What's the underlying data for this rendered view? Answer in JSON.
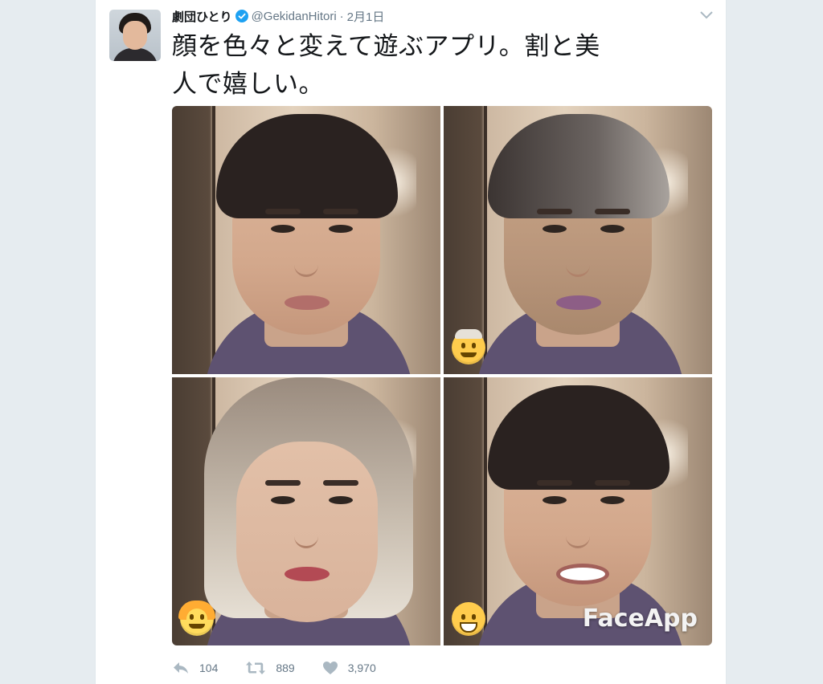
{
  "tweet": {
    "author_name": "劇団ひとり",
    "handle": "@GekidanHitori",
    "separator": "·",
    "time": "2月1日",
    "text": "顔を色々と変えて遊ぶアプリ。割と美人で嬉しい。",
    "text_line1": "顔を色々と変えて遊ぶアプリ。割と美",
    "text_line2": "人で嬉しい。"
  },
  "media": {
    "watermark": "FaceApp",
    "tiles": [
      {
        "filter": "original",
        "emoji_icon": ""
      },
      {
        "filter": "old",
        "emoji_icon": "older-man-emoji"
      },
      {
        "filter": "female",
        "emoji_icon": "woman-emoji"
      },
      {
        "filter": "smile",
        "emoji_icon": "grinning-face-emoji"
      }
    ]
  },
  "actions": {
    "reply_count": "104",
    "retweet_count": "889",
    "like_count": "3,970"
  },
  "colors": {
    "background": "#e6ecf0",
    "text": "#14171a",
    "secondary": "#657786",
    "verified": "#1da1f2"
  }
}
